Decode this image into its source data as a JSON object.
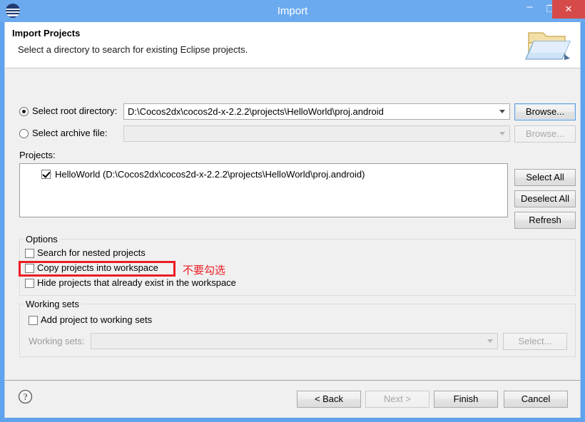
{
  "window": {
    "title": "Import",
    "app_icon": "eclipse-icon",
    "controls": {
      "minimize": "–",
      "maximize": "❐",
      "close": "✕"
    },
    "title_bar_color": "#6CAAF0",
    "close_button_color": "#D64A4A"
  },
  "header": {
    "title": "Import Projects",
    "subtitle": "Select a directory to search for existing Eclipse projects.",
    "icon": "open-folder-icon"
  },
  "source": {
    "root_directory": {
      "label": "Select root directory:",
      "selected": true,
      "value": "D:\\Cocos2dx\\cocos2d-x-2.2.2\\projects\\HelloWorld\\proj.android",
      "browse_label": "Browse...",
      "browse_enabled": true
    },
    "archive_file": {
      "label": "Select archive file:",
      "selected": false,
      "value": "",
      "browse_label": "Browse...",
      "browse_enabled": false
    }
  },
  "projects": {
    "label": "Projects:",
    "items": [
      {
        "checked": true,
        "text": "HelloWorld (D:\\Cocos2dx\\cocos2d-x-2.2.2\\projects\\HelloWorld\\proj.android)"
      }
    ],
    "buttons": {
      "select_all": "Select All",
      "deselect_all": "Deselect All",
      "refresh": "Refresh"
    }
  },
  "options": {
    "group_title": "Options",
    "checkboxes": [
      {
        "label": "Search for nested projects",
        "checked": false
      },
      {
        "label": "Copy projects into workspace",
        "checked": false
      },
      {
        "label": "Hide projects that already exist in the workspace",
        "checked": false
      }
    ]
  },
  "working_sets": {
    "group_title": "Working sets",
    "add_checkbox": {
      "label": "Add project to working sets",
      "checked": false
    },
    "field_label": "Working sets:",
    "field_value": "",
    "field_enabled": false,
    "select_button": {
      "label": "Select...",
      "enabled": false
    }
  },
  "annotation": {
    "text": "不要勾选",
    "color": "#ED1C24",
    "target": "Copy projects into workspace"
  },
  "footer": {
    "help_icon": "help-question-icon",
    "buttons": [
      {
        "label": "< Back",
        "enabled": true,
        "name": "back-button"
      },
      {
        "label": "Next >",
        "enabled": false,
        "name": "next-button"
      },
      {
        "label": "Finish",
        "enabled": true,
        "name": "finish-button"
      },
      {
        "label": "Cancel",
        "enabled": true,
        "name": "cancel-button"
      }
    ]
  }
}
